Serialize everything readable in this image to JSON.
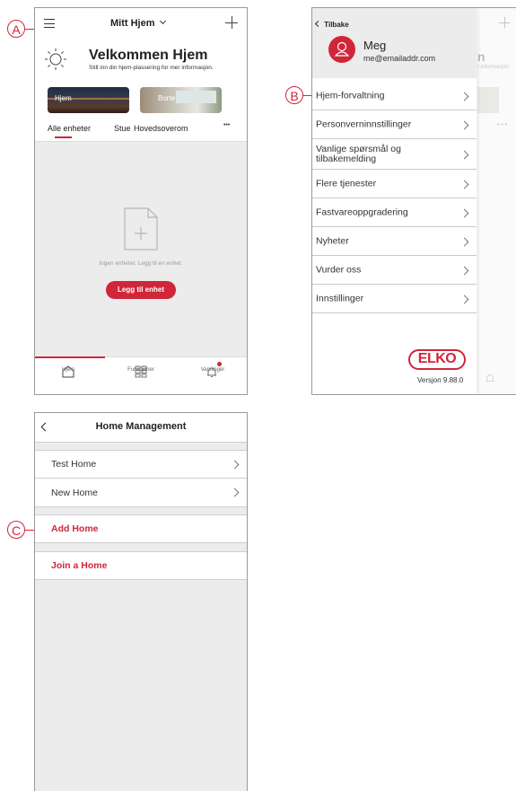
{
  "callouts": {
    "a": "A",
    "b": "B",
    "c": "C"
  },
  "screen1": {
    "home_title": "Mitt Hjem",
    "welcome_title": "Velkommen Hjem",
    "welcome_subtitle": "Still inn din hjem-plassering for mer informasjon.",
    "mode_home": "Hjem",
    "mode_away": "Borte",
    "tabs": [
      "Alle enheter",
      "Stue",
      "Hovedsoverom"
    ],
    "more_label": "• • •",
    "empty_text": "Ingen enheter. Legg til en enhet.",
    "add_device": "Legg til enhet",
    "bottom_nav": [
      "Hjem",
      "Funksjoner",
      "Varslinger"
    ]
  },
  "screen2": {
    "back_label": "Tilbake",
    "user_name": "Meg",
    "user_email": "me@emailaddr.com",
    "menu": [
      "Hjem-forvaltning",
      "Personverninnstillinger",
      "Vanlige spørsmål og tilbakemelding",
      "Flere tjenester",
      "Fastvareoppgradering",
      "Nyheter",
      "Vurder oss",
      "Innstillinger"
    ],
    "brand": "ELKO",
    "version": "Versjon 9.88.0",
    "behind_title_fragment": "n",
    "behind_sub_fragment": "r informasjon"
  },
  "screen3": {
    "title": "Home Management",
    "homes": [
      "Test Home",
      "New Home"
    ],
    "add_home": "Add Home",
    "join_home": "Join a Home"
  },
  "colors": {
    "accent": "#d0263a",
    "background": "#ececec"
  }
}
